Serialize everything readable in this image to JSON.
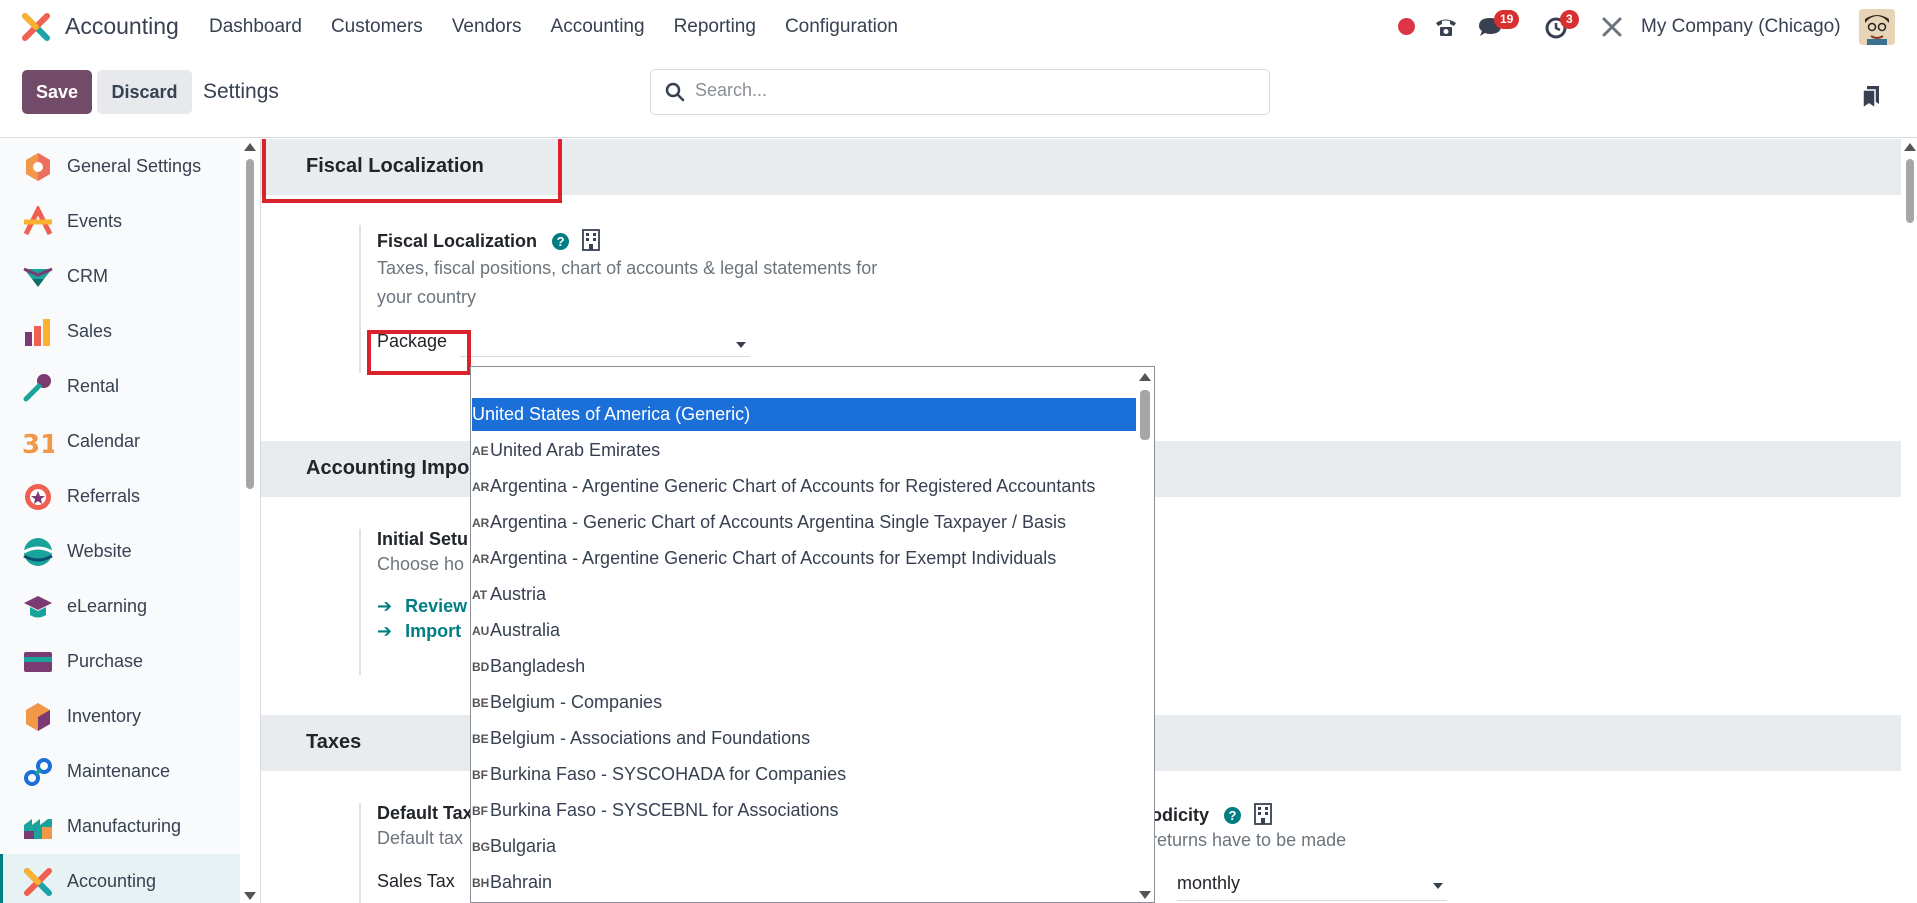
{
  "navbar": {
    "app_name": "Accounting",
    "menu": [
      "Dashboard",
      "Customers",
      "Vendors",
      "Accounting",
      "Reporting",
      "Configuration"
    ],
    "messages_count": "19",
    "activities_count": "3",
    "company": "My Company (Chicago)"
  },
  "control": {
    "save_label": "Save",
    "discard_label": "Discard",
    "title": "Settings",
    "search_placeholder": "Search..."
  },
  "sidebar": {
    "items": [
      {
        "label": "General Settings",
        "icon": "general-settings-icon"
      },
      {
        "label": "Events",
        "icon": "events-icon"
      },
      {
        "label": "CRM",
        "icon": "crm-icon"
      },
      {
        "label": "Sales",
        "icon": "sales-icon"
      },
      {
        "label": "Rental",
        "icon": "rental-icon"
      },
      {
        "label": "Calendar",
        "icon": "calendar-icon"
      },
      {
        "label": "Referrals",
        "icon": "referrals-icon"
      },
      {
        "label": "Website",
        "icon": "website-icon"
      },
      {
        "label": "eLearning",
        "icon": "elearning-icon"
      },
      {
        "label": "Purchase",
        "icon": "purchase-icon"
      },
      {
        "label": "Inventory",
        "icon": "inventory-icon"
      },
      {
        "label": "Maintenance",
        "icon": "maintenance-icon"
      },
      {
        "label": "Manufacturing",
        "icon": "manufacturing-icon"
      },
      {
        "label": "Accounting",
        "icon": "accounting-icon",
        "active": true
      }
    ]
  },
  "main": {
    "fiscal_section": "Fiscal Localization",
    "fiscal_setting_title": "Fiscal Localization",
    "fiscal_desc_1": "Taxes, fiscal positions, chart of accounts & legal statements for",
    "fiscal_desc_2": "your country",
    "package_label": "Package",
    "import_section": "Accounting Impor",
    "initial_setup_title": "Initial Setu",
    "initial_setup_desc": "Choose ho",
    "link_review": "Review",
    "link_import": "Import",
    "taxes_section": "Taxes",
    "default_taxes_title": "Default Tax",
    "default_taxes_desc": "Default tax",
    "sales_tax_label": "Sales Tax",
    "periodicity_title": "odicity",
    "periodicity_desc": "returns have to be made",
    "periodicity_value": "monthly",
    "calendar_day": "31"
  },
  "dropdown": {
    "options": [
      {
        "code": "",
        "label": "United States of America (Generic)",
        "selected": true
      },
      {
        "code": "AE",
        "label": "United Arab Emirates"
      },
      {
        "code": "AR",
        "label": "Argentina - Argentine Generic Chart of Accounts for Registered Accountants"
      },
      {
        "code": "AR",
        "label": "Argentina - Generic Chart of Accounts Argentina Single Taxpayer / Basis"
      },
      {
        "code": "AR",
        "label": "Argentina - Argentine Generic Chart of Accounts for Exempt Individuals"
      },
      {
        "code": "AT",
        "label": "Austria"
      },
      {
        "code": "AU",
        "label": "Australia"
      },
      {
        "code": "BD",
        "label": "Bangladesh"
      },
      {
        "code": "BE",
        "label": "Belgium - Companies"
      },
      {
        "code": "BE",
        "label": "Belgium - Associations and Foundations"
      },
      {
        "code": "BF",
        "label": "Burkina Faso - SYSCOHADA for Companies"
      },
      {
        "code": "BF",
        "label": "Burkina Faso - SYSCEBNL for Associations"
      },
      {
        "code": "BG",
        "label": "Bulgaria"
      },
      {
        "code": "BH",
        "label": "Bahrain"
      }
    ]
  },
  "colors": {
    "brand": "#714b67",
    "accent": "#017e84",
    "highlight": "#d9222b",
    "selected": "#1a6fd8"
  }
}
